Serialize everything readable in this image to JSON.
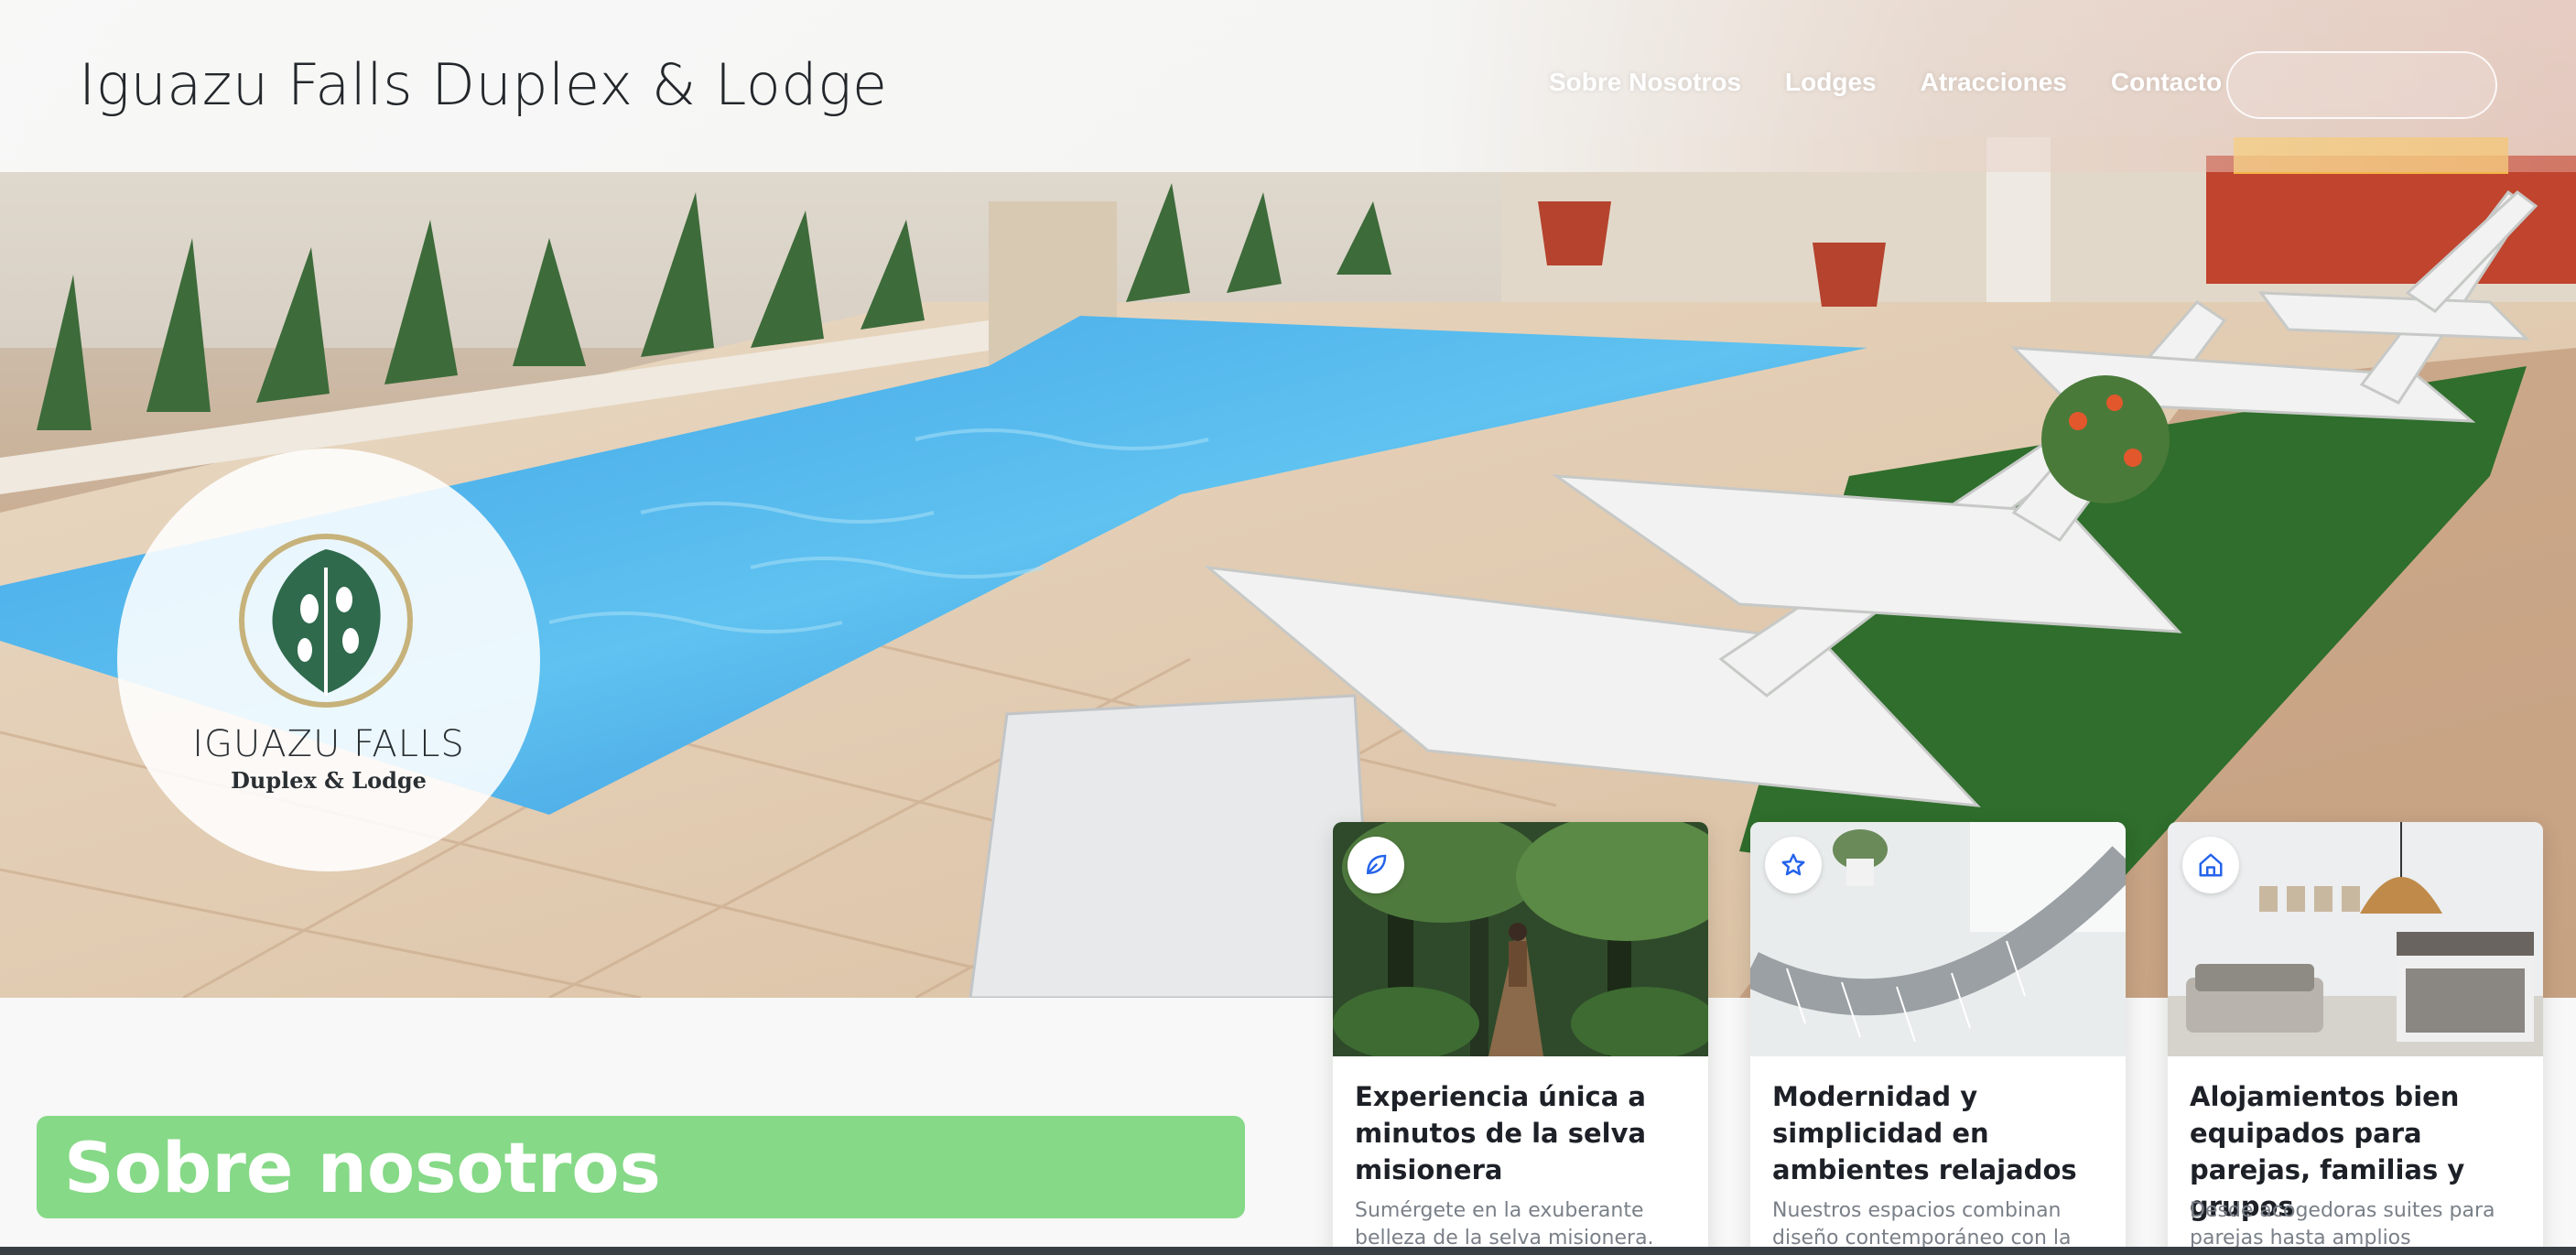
{
  "header": {
    "brand": "Iguazu Falls Duplex & Lodge",
    "nav": [
      {
        "label": "Sobre Nosotros"
      },
      {
        "label": "Lodges"
      },
      {
        "label": "Atracciones"
      },
      {
        "label": "Contacto"
      }
    ]
  },
  "logo": {
    "title": "IGUAZU FALLS",
    "subtitle": "Duplex & Lodge",
    "icon": "monstera-leaf-icon"
  },
  "section": {
    "title": "Sobre nosotros"
  },
  "cards": [
    {
      "icon": "leaf-icon",
      "title": "Experiencia única a minutos de la selva misionera",
      "text": "Sumérgete en la exuberante belleza de la selva misionera. Descubrí el"
    },
    {
      "icon": "star-icon",
      "title": "Modernidad y simplicidad en ambientes relajados",
      "text": "Nuestros espacios combinan diseño contemporáneo con la calidez de la"
    },
    {
      "icon": "home-icon",
      "title": "Alojamientos bien equipados para parejas, familias y grupos",
      "text": "Desde acogedoras suites para parejas hasta amplios"
    }
  ],
  "colors": {
    "accent_green": "#86d987",
    "logo_green": "#2f6a4d",
    "logo_gold": "#c6b27a",
    "icon_blue": "#2563eb"
  }
}
